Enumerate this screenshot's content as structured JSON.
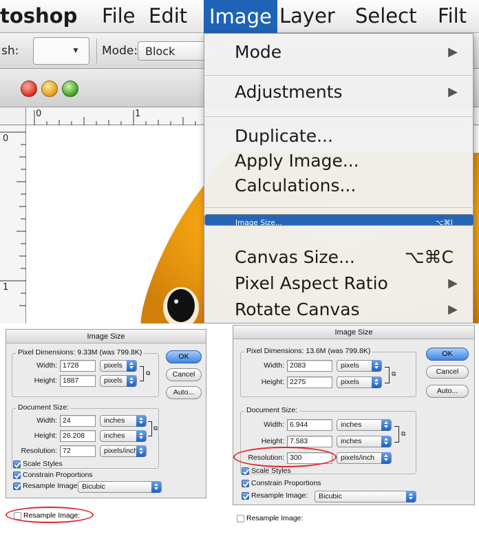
{
  "menubar": {
    "app_name": "toshop",
    "items": [
      "File",
      "Edit",
      "Image",
      "Layer",
      "Select",
      "Filt"
    ],
    "active_item": "Image"
  },
  "options_bar": {
    "brush_label": "sh:",
    "mode_label": "Mode:",
    "mode_value": "Block"
  },
  "rulers": {
    "h_ticks": [
      "0",
      "1"
    ],
    "v_ticks": [
      "0",
      "1"
    ]
  },
  "image_menu": {
    "items": [
      {
        "label": "Mode",
        "submenu": true
      },
      {
        "label": "Adjustments",
        "submenu": true
      },
      {
        "label": "Duplicate..."
      },
      {
        "label": "Apply Image..."
      },
      {
        "label": "Calculations..."
      },
      {
        "label": "Image Size...",
        "shortcut": "⌥⌘I",
        "selected": true
      },
      {
        "label": "Canvas Size...",
        "shortcut": "⌥⌘C"
      },
      {
        "label": "Pixel Aspect Ratio",
        "submenu": true
      },
      {
        "label": "Rotate Canvas",
        "submenu": true
      }
    ]
  },
  "dialog_left": {
    "title": "Image Size",
    "pixel_dimensions": "Pixel Dimensions:  9.33M (was 799.8K)",
    "width_label": "Width:",
    "width_value": "1728",
    "width_unit": "pixels",
    "height_label": "Height:",
    "height_value": "1887",
    "height_unit": "pixels",
    "document_size": "Document Size:",
    "doc_width_value": "24",
    "doc_width_unit": "inches",
    "doc_height_value": "26.208",
    "doc_height_unit": "inches",
    "resolution_label": "Resolution:",
    "resolution_value": "72",
    "resolution_unit": "pixels/inch",
    "ok": "OK",
    "cancel": "Cancel",
    "auto": "Auto...",
    "scale_styles": "Scale Styles",
    "constrain": "Constrain Proportions",
    "resample": "Resample Image:",
    "resample_value": "Bicubic",
    "resample_off": "Resample Image:"
  },
  "dialog_right": {
    "title": "Image Size",
    "pixel_dimensions": "Pixel Dimensions:  13.6M (was 799.8K)",
    "width_label": "Width:",
    "width_value": "2083",
    "width_unit": "pixels",
    "height_label": "Height:",
    "height_value": "2275",
    "height_unit": "pixels",
    "document_size": "Document Size:",
    "doc_width_value": "6.944",
    "doc_width_unit": "inches",
    "doc_height_value": "7.583",
    "doc_height_unit": "inches",
    "resolution_label": "Resolution:",
    "resolution_value": "300",
    "resolution_unit": "pixels/inch",
    "ok": "OK",
    "cancel": "Cancel",
    "auto": "Auto...",
    "scale_styles": "Scale Styles",
    "constrain": "Constrain Proportions",
    "resample": "Resample Image:",
    "resample_value": "Bicubic",
    "resample_off": "Resample Image:"
  },
  "colors": {
    "menu_highlight": "#2465b7",
    "annotation_red": "#e0262c",
    "default_button": "#3f85e0"
  }
}
